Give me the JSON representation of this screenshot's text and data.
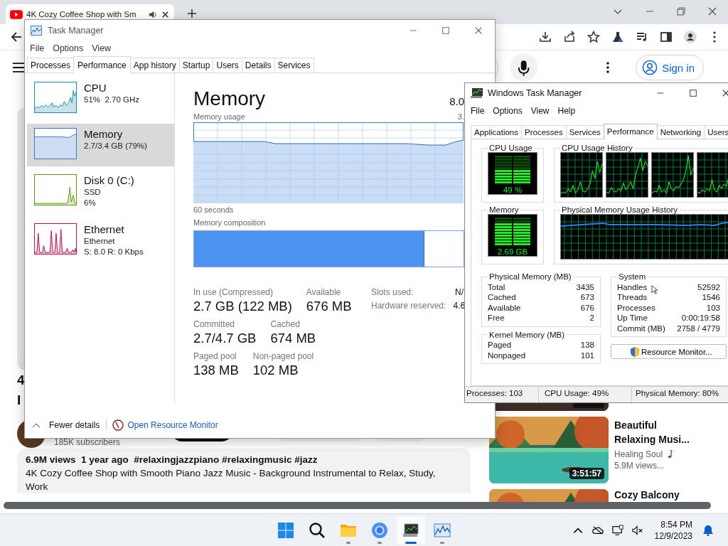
{
  "browser": {
    "tab": {
      "title": "4K Cozy Coffee Shop with Sm"
    },
    "header": {
      "sign_in": "Sign in"
    },
    "video": {
      "title_fragments": [
        "4",
        "I"
      ],
      "subscribers": "185K subscribers",
      "description": {
        "stats": "6.9M views  1 year ago  #relaxingjazzpiano #relaxingmusic #jazz",
        "text": "4K Cozy Coffee Shop with Smooth Piano Jazz Music - Background Instrumental to Relax, Study,",
        "more": "Work"
      }
    },
    "recommendations": [
      {
        "title": "Beautiful Relaxing Musi...",
        "channel": "Healing Soul",
        "meta": "5.9M views...",
        "duration": "3:51:57"
      },
      {
        "title": "Cozy Balcony"
      }
    ]
  },
  "task_manager": {
    "title": "Task Manager",
    "menu": [
      "File",
      "Options",
      "View"
    ],
    "tabs": [
      {
        "label": "Processes",
        "selected": false
      },
      {
        "label": "Performance",
        "selected": true
      },
      {
        "label": "App history",
        "selected": false
      },
      {
        "label": "Startup",
        "selected": false
      },
      {
        "label": "Users",
        "selected": false
      },
      {
        "label": "Details",
        "selected": false
      },
      {
        "label": "Services",
        "selected": false
      }
    ],
    "resources": [
      {
        "kind": "cpu",
        "name": "CPU",
        "details": [
          "51%  2.70 GHz"
        ],
        "color": "#1b8fae",
        "selected": false
      },
      {
        "kind": "memory",
        "name": "Memory",
        "details": [
          "2.7/3.4 GB (79%)"
        ],
        "color": "#3a78c8",
        "selected": true
      },
      {
        "kind": "disk",
        "name": "Disk 0 (C:)",
        "details": [
          "SSD",
          "6%"
        ],
        "color": "#5f9a12",
        "selected": false
      },
      {
        "kind": "network",
        "name": "Ethernet",
        "details": [
          "Ethernet",
          "S: 8.0 R: 0 Kbps"
        ],
        "color": "#b0124e",
        "selected": false
      }
    ],
    "detail": {
      "title": "Memory",
      "total": "8.0",
      "usage_label": "Memory usage",
      "usage_max": "3.",
      "time_span": "60 seconds",
      "composition_label": "Memory composition",
      "composition": {
        "level": 0.855
      },
      "stats": [
        [
          {
            "label": "In use (Compressed)",
            "value": "2.7 GB (122 MB)"
          },
          {
            "label": "Available",
            "value": "676 MB"
          }
        ],
        [
          {
            "label": "Committed",
            "value": "2.7/4.7 GB"
          },
          {
            "label": "Cached",
            "value": "674 MB"
          }
        ],
        [
          {
            "label": "Paged pool",
            "value": "138 MB"
          },
          {
            "label": "Non-paged pool",
            "value": "102 MB"
          }
        ]
      ],
      "specs": [
        {
          "label": "Slots used:",
          "value": "N/"
        },
        {
          "label": "Hardware reserved:",
          "value": "4.6"
        }
      ]
    },
    "footer": {
      "fewer": "Fewer details",
      "link": "Open Resource Monitor"
    }
  },
  "classic_task_manager": {
    "title": "Windows Task Manager",
    "menu": [
      "File",
      "Options",
      "View",
      "Help"
    ],
    "tabs": [
      {
        "label": "Applications",
        "selected": false
      },
      {
        "label": "Processes",
        "selected": false
      },
      {
        "label": "Services",
        "selected": false
      },
      {
        "label": "Performance",
        "selected": true
      },
      {
        "label": "Networking",
        "selected": false
      },
      {
        "label": "Users",
        "selected": false
      }
    ],
    "cpu": {
      "label": "CPU Usage",
      "reading": "49 %",
      "level": 0.49,
      "history_label": "CPU Usage History"
    },
    "memory": {
      "label": "Memory",
      "reading": "2.69 GB",
      "level": 0.79,
      "history_label": "Physical Memory Usage History"
    },
    "physical_memory": {
      "title": "Physical Memory (MB)",
      "rows": [
        {
          "label": "Total",
          "value": "3435"
        },
        {
          "label": "Cached",
          "value": "673"
        },
        {
          "label": "Available",
          "value": "676"
        },
        {
          "label": "Free",
          "value": "2"
        }
      ]
    },
    "kernel_memory": {
      "title": "Kernel Memory (MB)",
      "rows": [
        {
          "label": "Paged",
          "value": "138"
        },
        {
          "label": "Nonpaged",
          "value": "101"
        }
      ]
    },
    "system": {
      "title": "System",
      "rows": [
        {
          "label": "Handles",
          "value": "52592"
        },
        {
          "label": "Threads",
          "value": "1546"
        },
        {
          "label": "Processes",
          "value": "103"
        },
        {
          "label": "Up Time",
          "value": "0:00:19:58"
        },
        {
          "label": "Commit (MB)",
          "value": "2758 / 4779"
        }
      ]
    },
    "button": "Resource Monitor...",
    "status": [
      "Processes: 103",
      "CPU Usage: 49%",
      "Physical Memory: 80%"
    ]
  },
  "taskbar": {
    "apps": [
      {
        "kind": "start",
        "running": false,
        "selected": false
      },
      {
        "kind": "search",
        "running": false,
        "selected": false
      },
      {
        "kind": "folder",
        "running": true,
        "selected": false
      },
      {
        "kind": "browser",
        "running": true,
        "selected": false
      },
      {
        "kind": "task-manager",
        "running": true,
        "selected": true
      },
      {
        "kind": "monitor",
        "running": true,
        "selected": false
      }
    ],
    "time": "8:54 PM",
    "date": "12/9/2023"
  }
}
